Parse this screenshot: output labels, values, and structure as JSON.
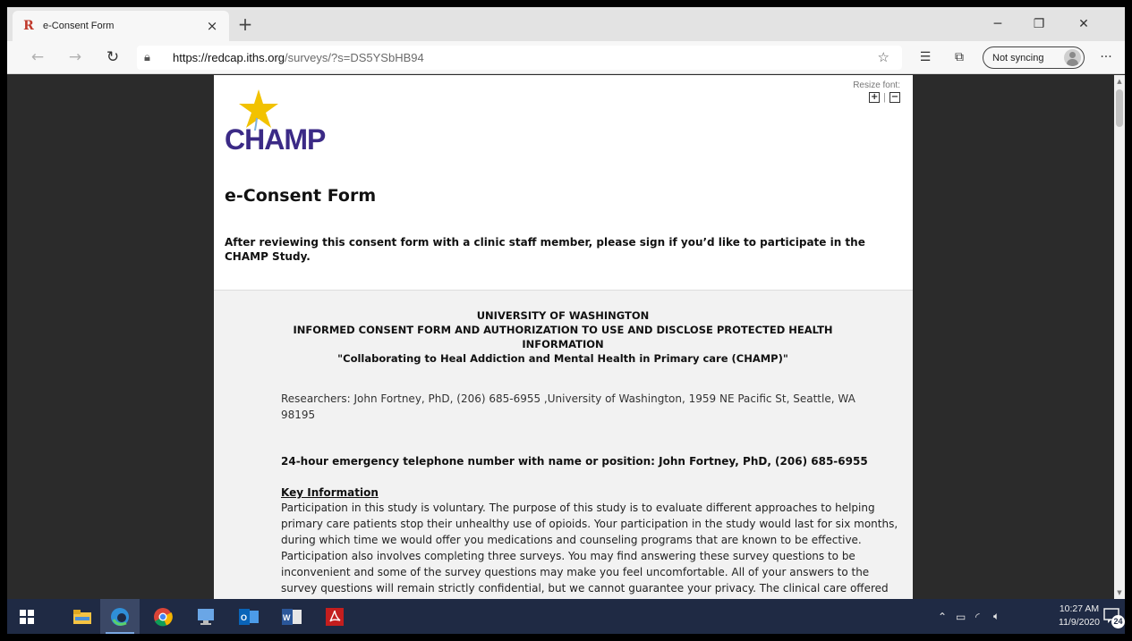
{
  "browser": {
    "tab_title": "e-Consent Form",
    "tab_close": "×",
    "new_tab": "+",
    "url_host": "https://redcap.iths.org",
    "url_path": "/surveys/?s=DS5YSbHB94",
    "sync_label": "Not syncing",
    "more_label": "···"
  },
  "page": {
    "resize_label": "Resize font:",
    "logo_text": "CHAMP",
    "form_title": "e-Consent Form",
    "instructions": "After reviewing this consent form with a clinic staff member, please sign if you’d like to participate in the CHAMP Study."
  },
  "consent": {
    "header_1": "UNIVERSITY OF WASHINGTON",
    "header_2": "INFORMED CONSENT FORM AND AUTHORIZATION TO USE AND DISCLOSE PROTECTED HEALTH INFORMATION",
    "header_3": "\"Collaborating to Heal Addiction and Mental Health in Primary care (CHAMP)\"",
    "researchers": "Researchers: John Fortney, PhD, (206) 685-6955 ,University of Washington, 1959 NE Pacific St, Seattle, WA 98195",
    "emergency": "24-hour emergency telephone number with name or position: John Fortney, PhD, (206) 685-6955",
    "key_heading": "Key Information",
    "key_text": "Participation in this study is voluntary. The purpose of this study is to evaluate different approaches to helping primary care patients stop their unhealthy use of opioids. Your participation in the study would last for six months, during which time we would offer you medications and counseling programs that are known to be effective. Participation also involves completing three surveys. You may find answering these survey questions to be inconvenient and some of the survey questions may make you feel uncomfortable. All of your answers to the survey questions will remain strictly confidential, but we cannot guarantee your privacy. The clinical care offered to you is designed to help stop the unhealthy use of opioids, but there is no"
  },
  "taskbar": {
    "clock_time": "10:27 AM",
    "clock_date": "11/9/2020",
    "notification_count": "24"
  },
  "colors": {
    "logo_purple": "#3b2a86",
    "logo_star": "#f2c200",
    "taskbar": "#1f2a44"
  }
}
